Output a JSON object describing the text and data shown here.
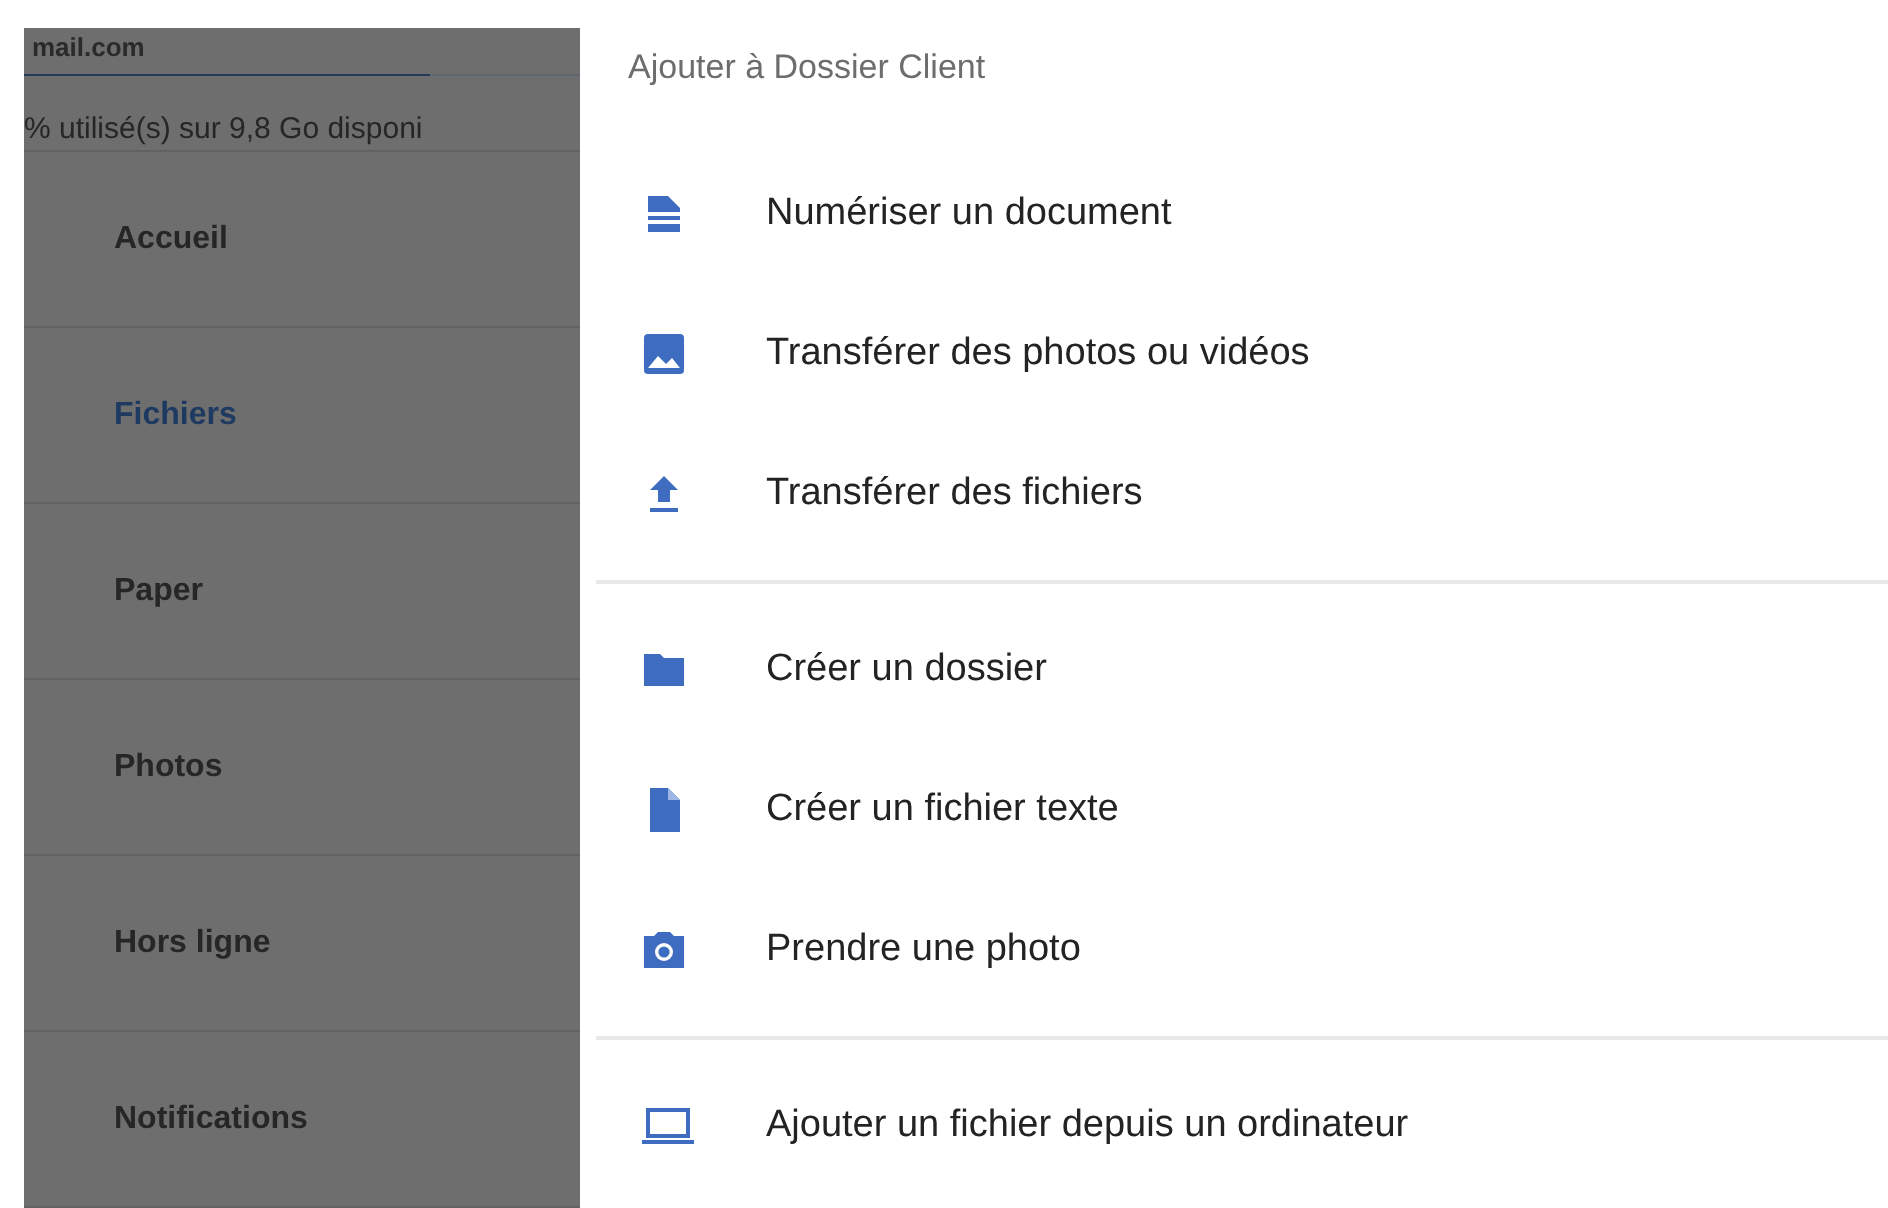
{
  "drawer": {
    "account": "mail.com",
    "storage": {
      "level": 0.73,
      "text": "% utilisé(s) sur 9,8 Go disponi"
    },
    "items": [
      {
        "label": "Accueil",
        "selected": false
      },
      {
        "label": "Fichiers",
        "selected": true
      },
      {
        "label": "Paper",
        "selected": false
      },
      {
        "label": "Photos",
        "selected": false
      },
      {
        "label": "Hors ligne",
        "selected": false
      },
      {
        "label": "Notifications",
        "selected": false
      }
    ]
  },
  "sheet": {
    "title": "Ajouter à Dossier Client",
    "groups": [
      [
        {
          "kind": "scan",
          "label": "Numériser un document"
        },
        {
          "kind": "image",
          "label": "Transférer des photos ou vidéos"
        },
        {
          "kind": "upload",
          "label": "Transférer des fichiers"
        }
      ],
      [
        {
          "kind": "folder",
          "label": "Créer un dossier"
        },
        {
          "kind": "file",
          "label": "Créer un fichier texte"
        },
        {
          "kind": "camera",
          "label": "Prendre une photo"
        }
      ],
      [
        {
          "kind": "laptop",
          "label": "Ajouter un fichier depuis un ordinateur"
        }
      ]
    ]
  }
}
